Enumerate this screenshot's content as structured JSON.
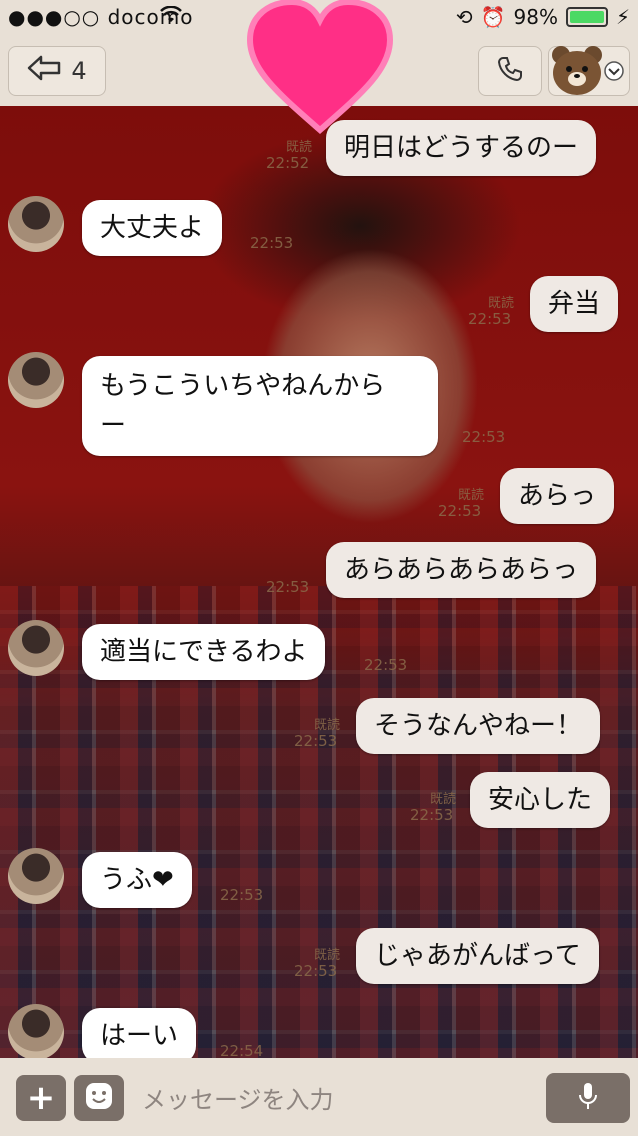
{
  "status_bar": {
    "carrier": "●●●○○ docomo",
    "battery": "98%"
  },
  "header": {
    "back_count": "4"
  },
  "input_bar": {
    "placeholder": "メッセージを入力"
  },
  "messages": [
    {
      "side": "out",
      "text": "明日はどうするのー",
      "read": "既読",
      "time": "22:52"
    },
    {
      "side": "in",
      "text": "大丈夫よ",
      "time": "22:53"
    },
    {
      "side": "out",
      "text": "弁当",
      "read": "既読",
      "time": "22:53"
    },
    {
      "side": "in",
      "text": "もうこういちやねんから",
      "text2": "ー",
      "time": "22:53"
    },
    {
      "side": "out",
      "text": "あらっ",
      "read": "既読",
      "time": "22:53"
    },
    {
      "side": "out",
      "text": "あらあらあらあらっ",
      "time": "22:53"
    },
    {
      "side": "in",
      "text": "適当にできるわよ",
      "time": "22:53"
    },
    {
      "side": "out",
      "text": "そうなんやねー！",
      "read": "既読",
      "time": "22:53"
    },
    {
      "side": "out",
      "text": "安心した",
      "read": "既読",
      "time": "22:53"
    },
    {
      "side": "in",
      "text": "うふ❤",
      "time": "22:53"
    },
    {
      "side": "out",
      "text": "じゃあがんばって",
      "read": "既読",
      "time": "22:53"
    },
    {
      "side": "in",
      "text": "はーい",
      "time": "22:54"
    }
  ]
}
